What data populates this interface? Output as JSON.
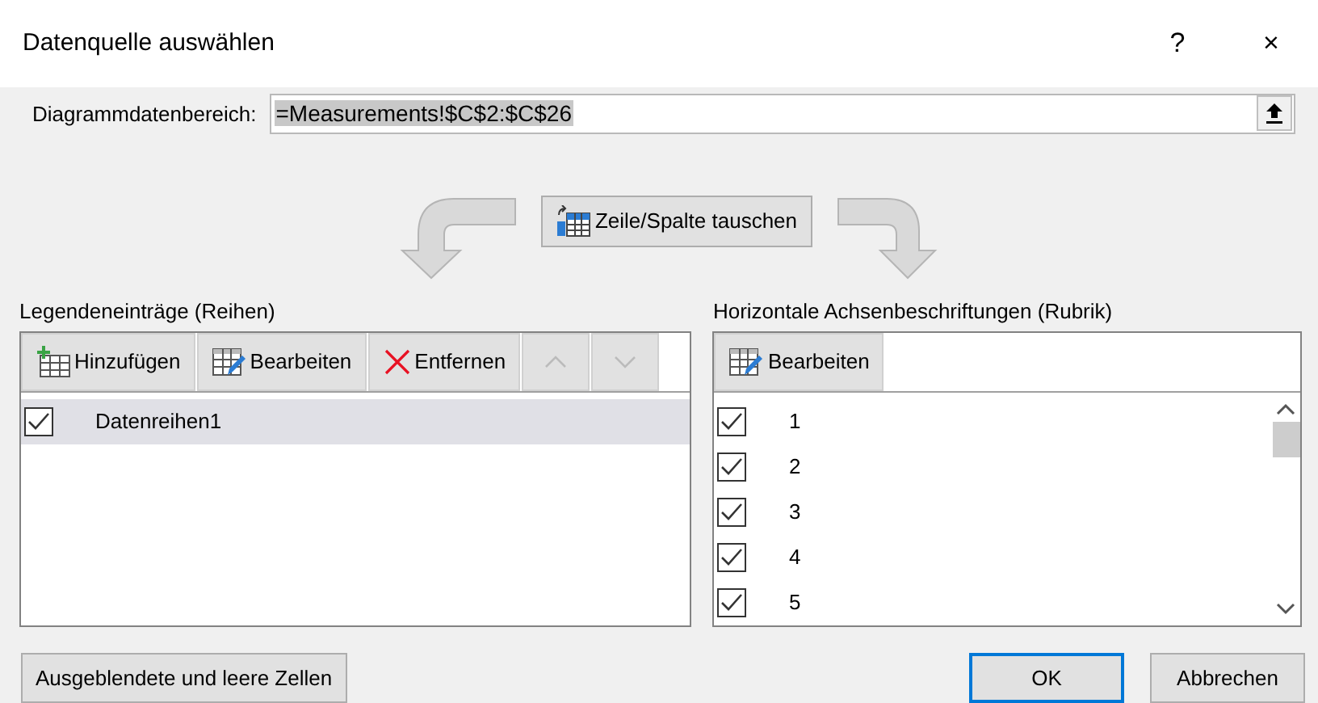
{
  "window": {
    "title": "Datenquelle auswählen",
    "help": "?",
    "close": "×"
  },
  "range": {
    "label": "Diagrammdatenbereich:",
    "value": "=Measurements!$C$2:$C$26"
  },
  "swap_button": "Zeile/Spalte tauschen",
  "legend": {
    "title": "Legendeneinträge (Reihen)",
    "buttons": [
      {
        "kind": "add",
        "label": "Hinzufügen"
      },
      {
        "kind": "edit",
        "label": "Bearbeiten"
      },
      {
        "kind": "remove",
        "label": "Entfernen"
      },
      {
        "kind": "up",
        "disabled": true
      },
      {
        "kind": "down",
        "disabled": true
      }
    ],
    "items": [
      {
        "label": "Datenreihen1",
        "checked": true,
        "selected": true
      }
    ]
  },
  "axis": {
    "title": "Horizontale Achsenbeschriftungen (Rubrik)",
    "buttons": [
      {
        "kind": "edit",
        "label": "Bearbeiten"
      }
    ],
    "items": [
      {
        "label": "1",
        "checked": true,
        "selected": false
      },
      {
        "label": "2",
        "checked": true,
        "selected": false
      },
      {
        "label": "3",
        "checked": true,
        "selected": false
      },
      {
        "label": "4",
        "checked": true,
        "selected": false
      },
      {
        "label": "5",
        "checked": true,
        "selected": false
      }
    ]
  },
  "footer": {
    "hidden_cells_button": "Ausgeblendete und leere Zellen",
    "ok": "OK",
    "cancel": "Abbrechen"
  }
}
